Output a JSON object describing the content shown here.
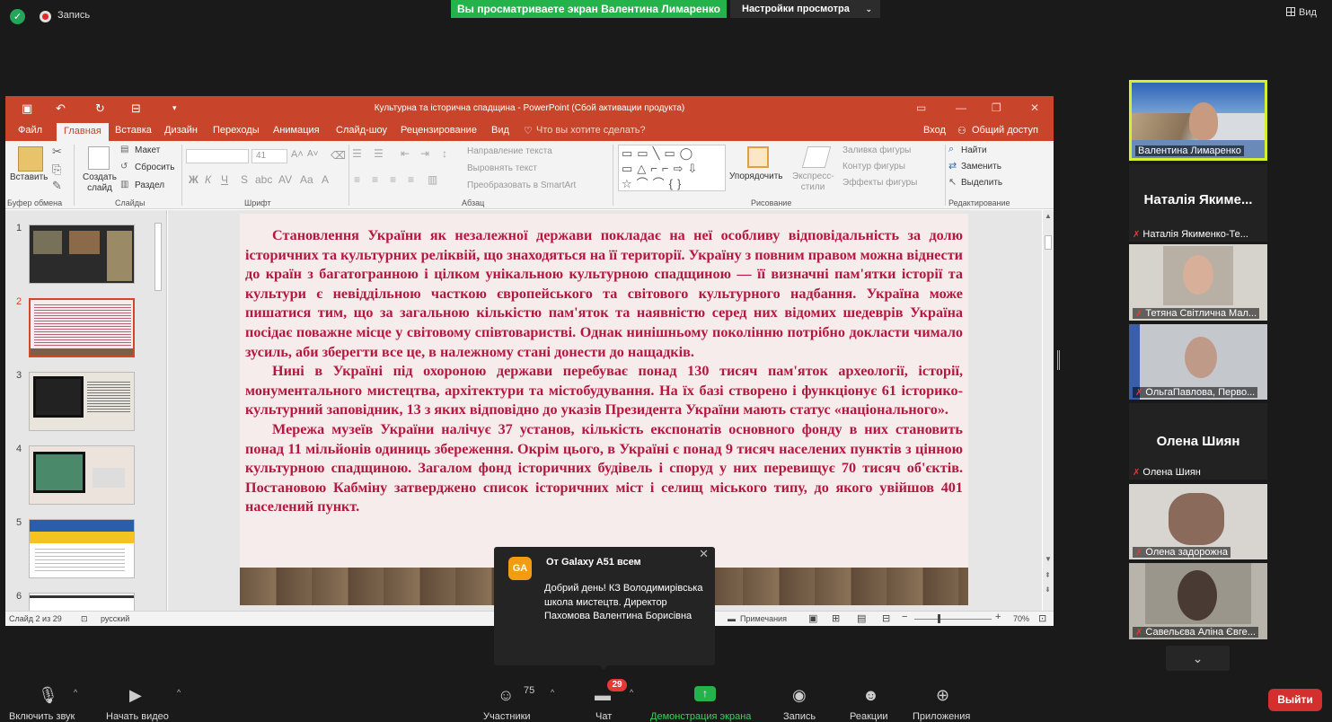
{
  "topbar": {
    "record_label": "Запись",
    "share_banner": "Вы просматриваете экран Валентина Лимаренко",
    "view_settings": "Настройки просмотра",
    "view_button": "Вид"
  },
  "ppt": {
    "title": "Культурна та історична спадщина - PowerPoint (Сбой активации продукта)",
    "tabs": [
      "Файл",
      "Главная",
      "Вставка",
      "Дизайн",
      "Переходы",
      "Анимация",
      "Слайд-шоу",
      "Рецензирование",
      "Вид"
    ],
    "tell_me": "Что вы хотите сделать?",
    "login": "Вход",
    "share": "Общий доступ",
    "ribbon": {
      "paste": "Вставить",
      "create_slide": "Создать слайд",
      "layout": "Макет",
      "reset": "Сбросить",
      "section": "Раздел",
      "font_size": "41",
      "text_direction": "Направление текста",
      "align_text": "Выровнять текст",
      "smartart": "Преобразовать в SmartArt",
      "arrange": "Упорядочить",
      "express_styles": "Экспресс-стили",
      "shape_fill": "Заливка фигуры",
      "shape_outline": "Контур фигуры",
      "shape_effects": "Эффекты фигуры",
      "find": "Найти",
      "replace": "Заменить",
      "select": "Выделить",
      "groups": [
        "Буфер обмена",
        "Слайды",
        "Шрифт",
        "Абзац",
        "Рисование",
        "Редактирование"
      ]
    },
    "thumb_numbers": [
      "1",
      "2",
      "3",
      "4",
      "5",
      "6"
    ],
    "slide_paragraphs": [
      "Становлення України як незалежної держави покладає на неї особливу відповідальність за долю історичних та культурних реліквій, що знаходяться на її території. Україну з повним правом можна віднести до країн з багатогранною і цілком унікальною культурною спадщиною — її визначні пам'ятки історії та культури є невіддільною часткою європейського та світового культурного надбання. Україна може пишатися тим, що за загальною кількістю пам'яток та наявністю серед них відомих шедеврів Україна посідає поважне місце у світовому співтоваристві. Однак нинішньому поколінню потрібно докласти чимало зусиль, аби зберегти все це, в належному стані донести до нащадків.",
      "Нині в Україні під охороною держави перебуває понад 130 тисяч пам'яток археології, історії, монументального мистецтва, архітектури та містобудування. На їх базі створено і функціонує 61 історико-культурний заповідник, 13 з яких відповідно до указів Президента України мають статус «національного».",
      "Мережа музеїв України налічує 37 установ, кількість експонатів основного фонду в них становить понад 11 мільйонів одиниць збереження. Окрім цього, в Україні є понад 9 тисяч населених пунктів з цінною культурною спадщиною. Загалом фонд історичних будівель і споруд у них перевищує 70 тисяч об'єктів. Постановою Кабміну затверджено список історичних міст і селищ міського типу, до якого увійшов 401 населений пункт."
    ],
    "status": {
      "slide_info": "Слайд 2 из 29",
      "language": "русский",
      "notes": "Примечания",
      "zoom": "70%"
    }
  },
  "participants": [
    {
      "name": "Валентина Лимаренко",
      "video": true
    },
    {
      "name": "Наталія Якименко-Те...",
      "big": "Наталія Якиме..."
    },
    {
      "name": "Тетяна Світлична Мал...",
      "video": true
    },
    {
      "name": "ОльгаПавлова, Перво...",
      "video": true
    },
    {
      "name": "Олена Шиян",
      "big": "Олена Шиян"
    },
    {
      "name": "Олена задорожна",
      "video": true
    },
    {
      "name": "Савельєва Аліна Євге...",
      "video": true
    }
  ],
  "chat": {
    "avatar": "GA",
    "from": "От Galaxy A51 всем",
    "message": "Добрий день! КЗ Володимирівська школа мистецтв. Директор Пахомова Валентина Борисівна"
  },
  "toolbar": {
    "audio": "Включить звук",
    "video": "Начать видео",
    "participants": "Участники",
    "participants_count": "75",
    "chat": "Чат",
    "chat_badge": "29",
    "share_screen": "Демонстрация экрана",
    "record": "Запись",
    "reactions": "Реакции",
    "apps": "Приложения",
    "leave": "Выйти"
  },
  "colors": {
    "zoom_green": "#24b34b",
    "ppt_orange": "#c8452b",
    "slide_text": "#b5183e",
    "leave_red": "#d32f2f"
  }
}
